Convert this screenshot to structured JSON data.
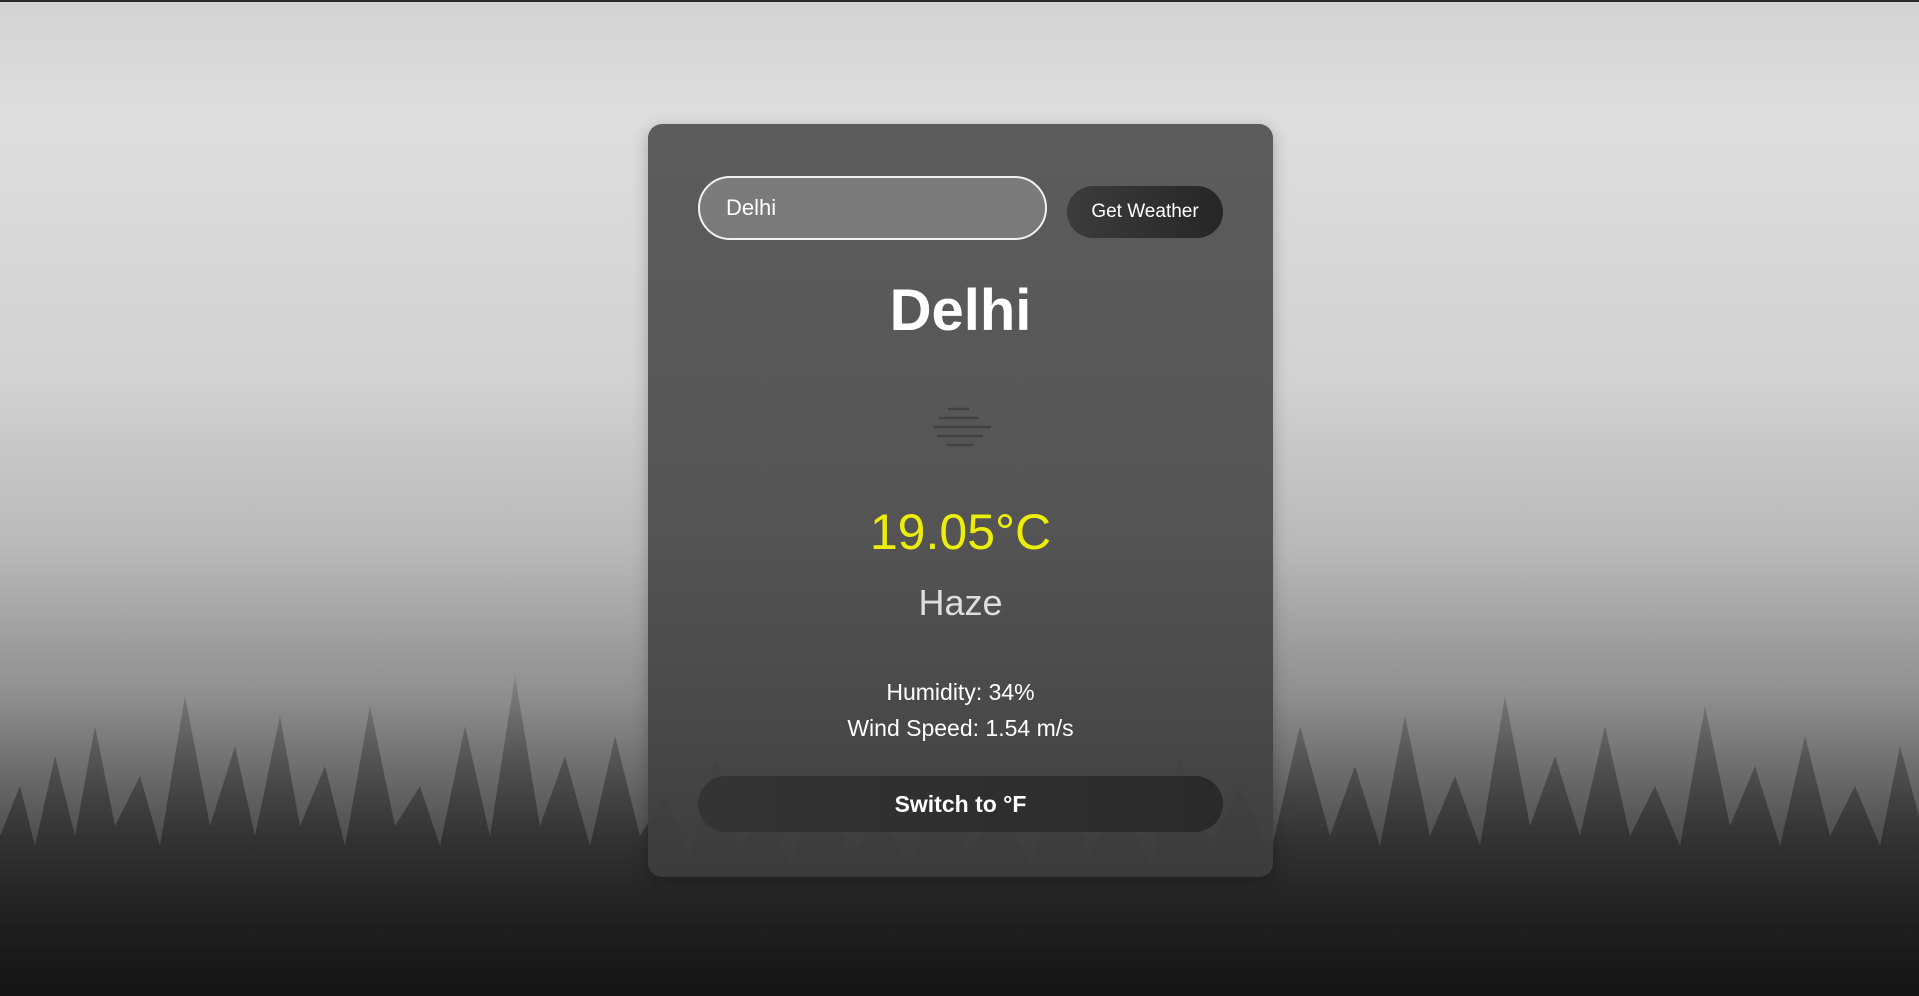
{
  "search": {
    "value": "Delhi",
    "button_label": "Get Weather"
  },
  "weather": {
    "city": "Delhi",
    "icon": "haze-icon",
    "temperature": "19.05°C",
    "description": "Haze",
    "humidity": "Humidity: 34%",
    "wind": "Wind Speed: 1.54 m/s"
  },
  "unit_toggle": {
    "label": "Switch to °F"
  },
  "colors": {
    "temperature": "#eded0a",
    "card": "#555555",
    "button": "#2e2e2e"
  }
}
